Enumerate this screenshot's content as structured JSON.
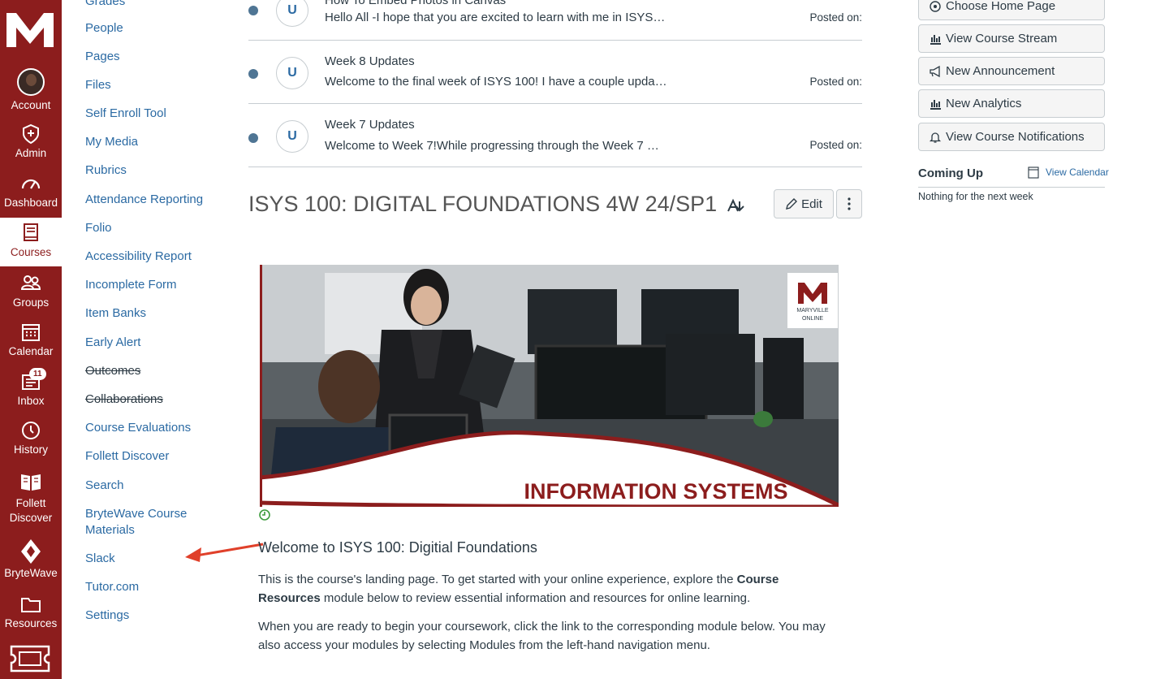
{
  "global_nav": {
    "items": [
      {
        "label": "Account",
        "icon": "avatar"
      },
      {
        "label": "Admin",
        "icon": "shield-icon"
      },
      {
        "label": "Dashboard",
        "icon": "dashboard-icon"
      },
      {
        "label": "Courses",
        "icon": "courses-icon"
      },
      {
        "label": "Groups",
        "icon": "groups-icon"
      },
      {
        "label": "Calendar",
        "icon": "calendar-icon"
      },
      {
        "label": "Inbox",
        "icon": "inbox-icon",
        "badge": "11"
      },
      {
        "label": "History",
        "icon": "clock-icon"
      },
      {
        "label": "Follett Discover",
        "icon": "follett-icon"
      },
      {
        "label": "BryteWave",
        "icon": "brytewave-icon"
      },
      {
        "label": "Resources",
        "icon": "folder-icon"
      }
    ],
    "brand_color": "#8c1d1d"
  },
  "course_nav": {
    "items": [
      "Grades",
      "People",
      "Pages",
      "Files",
      "Self Enroll Tool",
      "My Media",
      "Rubrics",
      "Attendance Reporting",
      "Folio",
      "Accessibility Report",
      "Incomplete Form",
      "Item Banks",
      "Early Alert",
      "Outcomes",
      "Collaborations",
      "Course Evaluations",
      "Follett Discover",
      "Search",
      "BryteWave Course Materials",
      "Slack",
      "Tutor.com",
      "Settings"
    ],
    "link_color": "#2b6aa3"
  },
  "announcements": [
    {
      "avatar": "U",
      "title": "How To Embed Photos in Canvas",
      "message": "Hello All -I hope that you are excited to learn with me in ISYS…",
      "posted": "Posted on:"
    },
    {
      "avatar": "U",
      "title": "Week 8 Updates",
      "message": "Welcome to the final week of ISYS 100! I have a couple upda…",
      "posted": "Posted on:"
    },
    {
      "avatar": "U",
      "title": "Week 7 Updates",
      "message": "Welcome to Week 7!While progressing through the Week 7 …",
      "posted": "Posted on:"
    }
  ],
  "course": {
    "title": "ISYS 100: DIGITAL FOUNDATIONS 4W 24/SP1",
    "edit_label": "Edit",
    "banner_text": "INFORMATION SYSTEMS",
    "banner_logo_line1": "MARYVILLE",
    "banner_logo_line2": "ONLINE",
    "welcome_heading": "Welcome to ISYS 100: Digitial Foundations",
    "p1_before": "This is the course's landing page. To get started with your online experience, explore the ",
    "p1_bold": "Course Resources",
    "p1_after": " module below to review essential information and resources for online learning.",
    "p2": "When you are ready to begin your coursework, click the link to the corresponding module below. You may also access your modules by selecting Modules from the left-hand navigation menu."
  },
  "sidebar": {
    "buttons": [
      {
        "label": "Choose Home Page",
        "icon": "target-icon"
      },
      {
        "label": "View Course Stream",
        "icon": "stats-icon"
      },
      {
        "label": "New Announcement",
        "icon": "megaphone-icon"
      },
      {
        "label": "New Analytics",
        "icon": "analytics-icon"
      },
      {
        "label": "View Course Notifications",
        "icon": "bell-icon"
      }
    ],
    "coming_up": "Coming Up",
    "view_calendar": "View Calendar",
    "nothing": "Nothing for the next week"
  }
}
